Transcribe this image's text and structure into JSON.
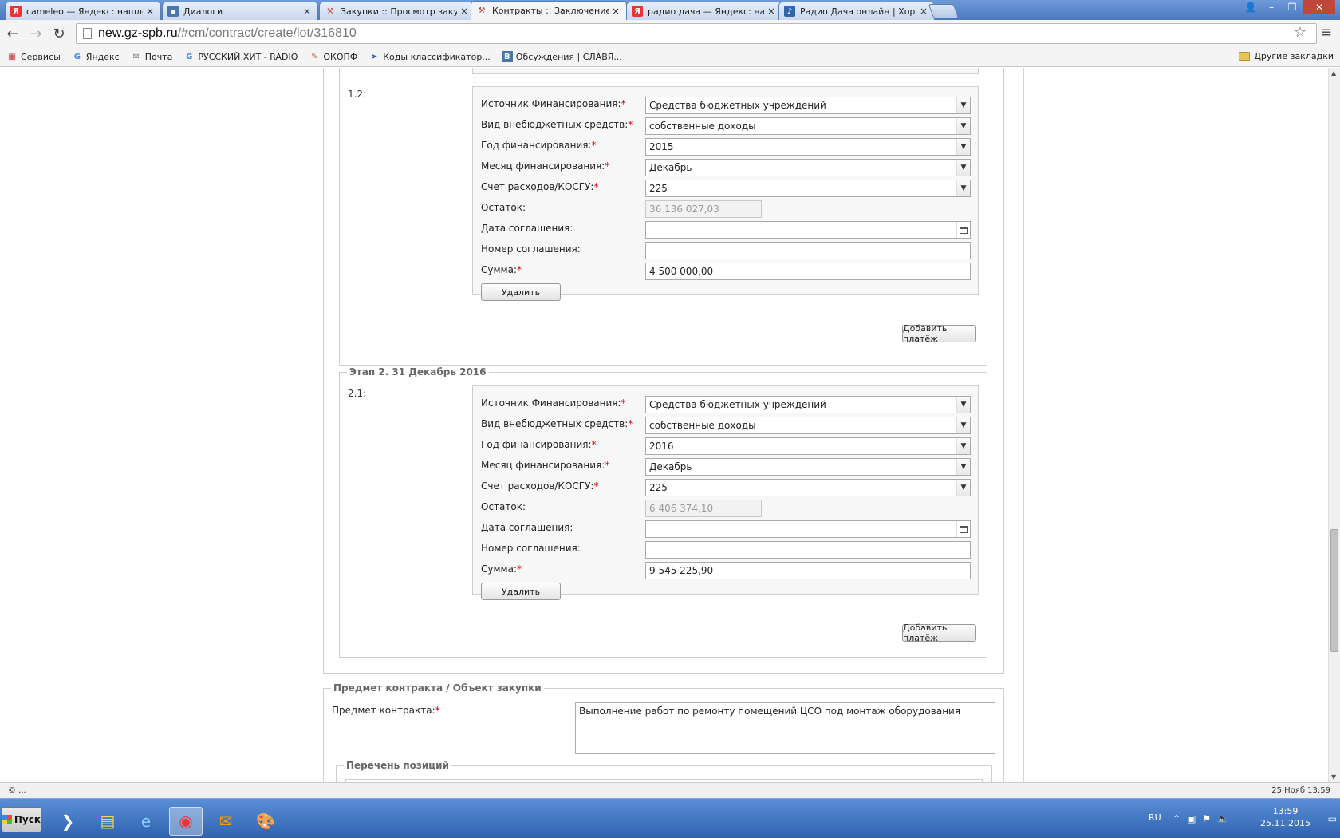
{
  "browser": {
    "tabs": [
      {
        "title": "cameleo — Яндекс: нашлос",
        "favicon": "yandex-icon",
        "color": "#e33"
      },
      {
        "title": "Диалоги",
        "favicon": "vk-icon",
        "color": "#4a76a8"
      },
      {
        "title": "Закупки :: Просмотр закуп",
        "favicon": "gavel-icon",
        "color": "#b44"
      },
      {
        "title": "Контракты :: Заключение д",
        "favicon": "gavel-icon",
        "color": "#b44"
      },
      {
        "title": "радио дача — Яндекс: наш",
        "favicon": "yandex-icon",
        "color": "#e33"
      },
      {
        "title": "Радио Дача онлайн | Хоро",
        "favicon": "radio-icon",
        "color": "#36a"
      }
    ],
    "tab_close": "×",
    "url_host": "new.gz-spb.ru",
    "url_path": "/#cm/contract/create/lot/316810",
    "bookmarks": [
      {
        "label": "Сервисы",
        "icon": "apps-icon"
      },
      {
        "label": "Яндекс",
        "icon": "google-icon"
      },
      {
        "label": "Почта",
        "icon": "mail-icon"
      },
      {
        "label": "РУССКИЙ ХИТ - RADIO",
        "icon": "google-icon"
      },
      {
        "label": "ОКОПФ",
        "icon": "tool-icon"
      },
      {
        "label": "Коды классификатор...",
        "icon": "bookmark-icon"
      },
      {
        "label": "Обсуждения | СЛАВЯ...",
        "icon": "vk-icon"
      }
    ],
    "other_bookmarks": "Другие закладки"
  },
  "form": {
    "payment_1_2": {
      "num": "1.2:",
      "labels": {
        "source": "Источник Финансирования:",
        "kind": "Вид внебюджетных средств:",
        "year": "Год финансирования:",
        "month": "Месяц финансирования:",
        "account": "Счет расходов/КОСГУ:",
        "balance": "Остаток:",
        "agr_date": "Дата соглашения:",
        "agr_num": "Номер соглашения:",
        "sum": "Сумма:"
      },
      "values": {
        "source": "Средства бюджетных учреждений",
        "kind": "собственные доходы",
        "year": "2015",
        "month": "Декабрь",
        "account": "225",
        "balance": "36 136 027,03",
        "agr_date": "",
        "agr_num": "",
        "sum": "4 500 000,00"
      },
      "delete_label": "Удалить"
    },
    "add_payment_1": "Добавить платёж",
    "stage2_legend": "Этап 2. 31 Декабрь 2016",
    "payment_2_1": {
      "num": "2.1:",
      "labels": {
        "source": "Источник Финансирования:",
        "kind": "Вид внебюджетных средств:",
        "year": "Год финансирования:",
        "month": "Месяц финансирования:",
        "account": "Счет расходов/КОСГУ:",
        "balance": "Остаток:",
        "agr_date": "Дата соглашения:",
        "agr_num": "Номер соглашения:",
        "sum": "Сумма:"
      },
      "values": {
        "source": "Средства бюджетных учреждений",
        "kind": "собственные доходы",
        "year": "2016",
        "month": "Декабрь",
        "account": "225",
        "balance": "6 406 374,10",
        "agr_date": "",
        "agr_num": "",
        "sum": "9 545 225,90"
      },
      "delete_label": "Удалить"
    },
    "add_payment_2": "Добавить платёж",
    "subject_legend": "Предмет контракта / Объект закупки",
    "subject_label": "Предмет контракта:",
    "subject_value": "Выполнение работ по ремонту помещений ЦСО под монтаж оборудования",
    "positions_legend": "Перечень позиций",
    "required_mark": "*"
  },
  "status": {
    "left": "© ...",
    "right": "25 Нояб 13:59"
  },
  "taskbar": {
    "start_label": "Пуск",
    "lang": "RU",
    "time": "13:59",
    "date": "25.11.2015"
  }
}
